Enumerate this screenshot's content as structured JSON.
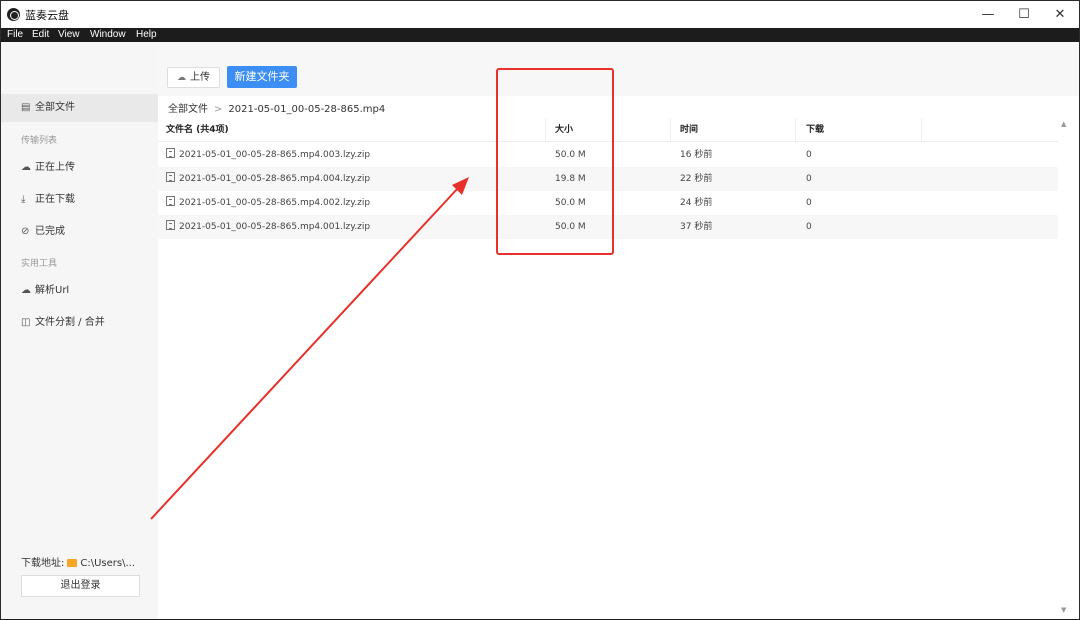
{
  "window": {
    "title": "蓝奏云盘",
    "controls": {
      "minimize": "—",
      "maximize": "☐",
      "close": "✕"
    }
  },
  "menu": [
    "File",
    "Edit",
    "View",
    "Window",
    "Help"
  ],
  "sidebar": {
    "all_files": "全部文件",
    "transfer_section": "传输列表",
    "uploading": "正在上传",
    "downloading": "正在下载",
    "done": "已完成",
    "tools_section": "实用工具",
    "parse_url": "解析Url",
    "split_merge": "文件分割 / 合并",
    "download_path_label": "下载地址:",
    "download_path_value": "C:\\Users\\...",
    "logout": "退出登录"
  },
  "toolbar": {
    "upload": "上传",
    "new_folder": "新建文件夹"
  },
  "breadcrumb": {
    "root": "全部文件",
    "separator": ">",
    "current": "2021-05-01_00-05-28-865.mp4"
  },
  "table": {
    "headers": {
      "name": "文件名 (共4项)",
      "size": "大小",
      "time": "时间",
      "downloads": "下载"
    },
    "rows": [
      {
        "name": "2021-05-01_00-05-28-865.mp4.003.lzy.zip",
        "size": "50.0 M",
        "time": "16 秒前",
        "downloads": "0"
      },
      {
        "name": "2021-05-01_00-05-28-865.mp4.004.lzy.zip",
        "size": "19.8 M",
        "time": "22 秒前",
        "downloads": "0"
      },
      {
        "name": "2021-05-01_00-05-28-865.mp4.002.lzy.zip",
        "size": "50.0 M",
        "time": "24 秒前",
        "downloads": "0"
      },
      {
        "name": "2021-05-01_00-05-28-865.mp4.001.lzy.zip",
        "size": "50.0 M",
        "time": "37 秒前",
        "downloads": "0"
      }
    ]
  },
  "colors": {
    "accent": "#3d8ef4",
    "annotation": "#e8312b",
    "folder": "#f5a623"
  }
}
